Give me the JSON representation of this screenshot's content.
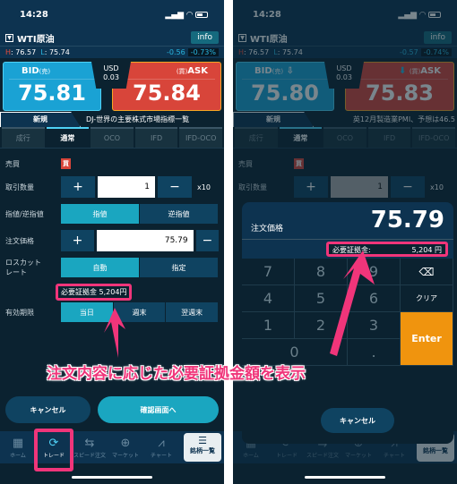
{
  "status": {
    "time": "14:28",
    "signal": "▂▄▆",
    "wifi": "◠"
  },
  "left": {
    "header": {
      "title": "WTI原油",
      "info": "info"
    },
    "hl": {
      "h_label": "H",
      "h": ": 76.57",
      "l_label": "L",
      "l": ": 75.74",
      "change": "-0.56",
      "pct": "-0.73%"
    },
    "bid": {
      "label": "BID",
      "sub": "(売)",
      "value": "75.81"
    },
    "ask": {
      "label": "ASK",
      "sub": "(買)",
      "value": "75.84"
    },
    "spread": {
      "ccy": "USD",
      "value": "0.03"
    },
    "tabs1": [
      "新規",
      "DJ-世界の主要株式市場指標一覧"
    ],
    "tabs2": [
      "成行",
      "通常",
      "OCO",
      "IFD",
      "IFD-OCO"
    ],
    "form": {
      "side_label": "売買",
      "side": "買",
      "qty_label": "取引数量",
      "qty": "1",
      "unit": "x10",
      "type_label": "指値/逆指値",
      "type_options": [
        "指値",
        "逆指値"
      ],
      "price_label": "注文価格",
      "price": "75.79",
      "losscut_label": "ロスカット\nレート",
      "losscut_options": [
        "自動",
        "指定"
      ],
      "margin": "必要証拠金 5,204円",
      "expiry_label": "有効期限",
      "expiry_options": [
        "当日",
        "週末",
        "翌週末"
      ]
    },
    "cancel": "キャンセル",
    "confirm": "確認画面へ"
  },
  "right": {
    "header": {
      "title": "WTI原油",
      "info": "info"
    },
    "hl": {
      "h_label": "H",
      "h": ": 76.57",
      "l_label": "L",
      "l": ": 75.74",
      "change": "-0.57",
      "pct": "-0.74%"
    },
    "bid": {
      "label": "BID",
      "sub": "(売)",
      "value": "75.80"
    },
    "ask": {
      "label": "ASK",
      "sub": "(買)",
      "value": "75.83"
    },
    "spread": {
      "ccy": "USD",
      "value": "0.03"
    },
    "tabs1": [
      "新規",
      "英12月製造業PMI、予想は46.5"
    ],
    "keypad": {
      "label": "注文価格",
      "value": "75.79",
      "margin_label": "必要証拠金:",
      "margin_value": "5,204 円",
      "keys": [
        "7",
        "8",
        "9",
        "⌫",
        "4",
        "5",
        "6",
        "クリア",
        "1",
        "2",
        "3",
        "Enter",
        "",
        "0",
        "."
      ],
      "cancel": "キャンセル"
    }
  },
  "nav": [
    {
      "icon": "▦",
      "label": "ホーム"
    },
    {
      "icon": "⟳",
      "label": "トレード"
    },
    {
      "icon": "⇆",
      "label": "スピード注文"
    },
    {
      "icon": "⊕",
      "label": "マーケット"
    },
    {
      "icon": "⩘",
      "label": "チャート"
    }
  ],
  "nav_list": {
    "icon": "☰",
    "label": "銘柄一覧"
  },
  "annotation": "注文内容に応じた必要証拠金額を表示",
  "colors": {
    "accent": "#1aa6c0",
    "bid": "#1aa2d4",
    "ask": "#d8453a",
    "highlight": "#f0357a",
    "enter": "#f0940e"
  }
}
